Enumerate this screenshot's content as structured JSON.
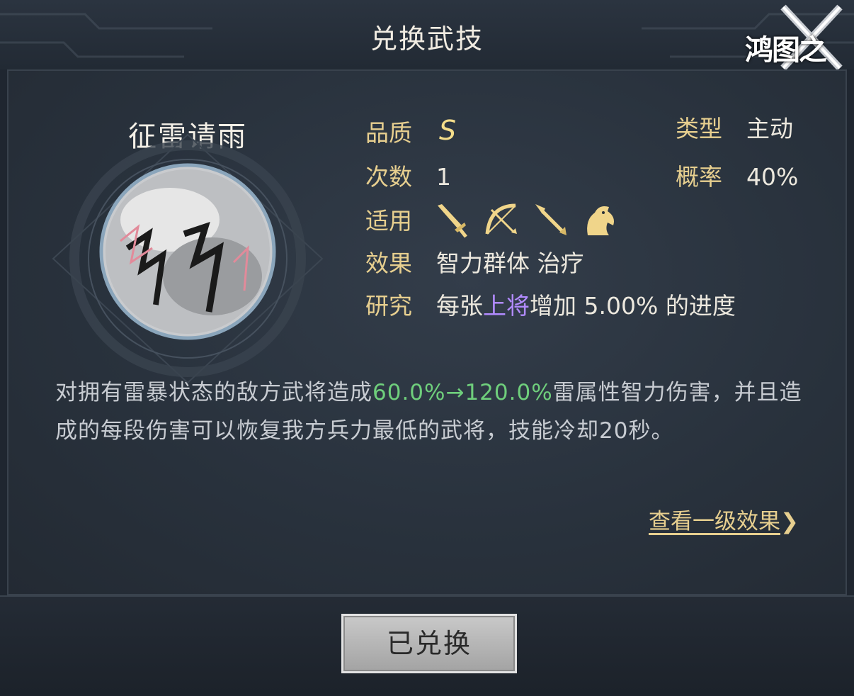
{
  "header": {
    "title": "兑换武技",
    "logo_text": "鸿图之下"
  },
  "skill": {
    "name": "征雷请雨",
    "quality_label": "品质",
    "quality_value": "S",
    "type_label": "类型",
    "type_value": "主动",
    "count_label": "次数",
    "count_value": "1",
    "rate_label": "概率",
    "rate_value": "40%",
    "applicable_label": "适用",
    "applicable_icons": [
      "sword-icon",
      "bow-icon",
      "spear-icon",
      "horse-icon"
    ],
    "effect_label": "效果",
    "effect_value": "智力群体 治疗",
    "research_label": "研究",
    "research_prefix": "每张",
    "research_highlight": "上将",
    "research_suffix": "增加 5.00% 的进度"
  },
  "description": {
    "part1": "对拥有雷暴状态的敌方武将造成",
    "highlight": "60.0%→120.0%",
    "part2": "雷属性智力伤害，并且造成的每段伤害可以恢复我方兵力最低的武将，技能冷却20秒。"
  },
  "link": {
    "label": "查看一级效果",
    "arrow": "❯"
  },
  "footer": {
    "button_label": "已兑换"
  },
  "colors": {
    "label_gold": "#e7cf8f",
    "highlight_green": "#6fcf7c",
    "highlight_purple": "#b28bff"
  }
}
